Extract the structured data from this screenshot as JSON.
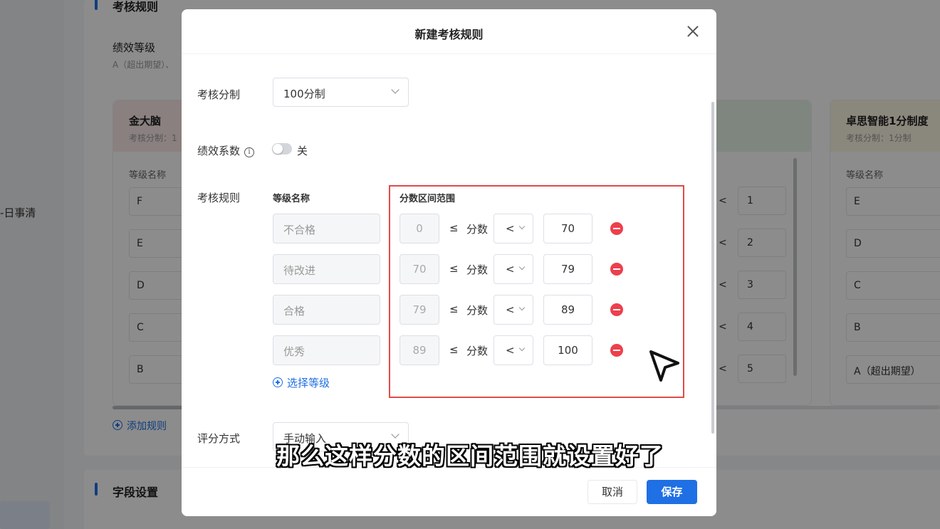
{
  "background": {
    "nav_item": "日事清",
    "section_title": "考核规则",
    "perf_level_title": "绩效等级",
    "perf_level_sub": "A（超出期望）、",
    "add_rule": "添加规则",
    "field_settings": "字段设置",
    "card_left": {
      "name": "金大脑",
      "sub": "考核分制：1",
      "grade_label": "等级名称",
      "grades": [
        "F",
        "E",
        "D",
        "C",
        "B"
      ]
    },
    "card_right": {
      "name": "卓思智能1分制度",
      "sub": "考核分制：1分制",
      "grade_label": "等级名称",
      "grades": [
        "E",
        "D",
        "C",
        "B",
        "A（超出期望）"
      ]
    },
    "right_values": [
      "1",
      "2",
      "3",
      "4",
      "5"
    ],
    "lt_symbol": "<"
  },
  "modal": {
    "title": "新建考核规则",
    "score_system_label": "考核分制",
    "score_system_value": "100分制",
    "coefficient_label": "绩效系数",
    "coefficient_toggle_text": "关",
    "rules_label": "考核规则",
    "col_grade_name": "等级名称",
    "col_score_range": "分数区间范围",
    "le_symbol": "≤",
    "score_word": "分数",
    "rows": [
      {
        "grade": "不合格",
        "min": "0",
        "op": "<",
        "max": "70"
      },
      {
        "grade": "待改进",
        "min": "70",
        "op": "<",
        "max": "79"
      },
      {
        "grade": "合格",
        "min": "79",
        "op": "<",
        "max": "89"
      },
      {
        "grade": "优秀",
        "min": "89",
        "op": "<",
        "max": "100"
      }
    ],
    "add_grade": "选择等级",
    "scoring_method_label": "评分方式",
    "scoring_method_value": "手动输入",
    "cancel": "取消",
    "save": "保存"
  },
  "caption": "那么这样分数的区间范围就设置好了",
  "colors": {
    "accent": "#1f6fe5",
    "danger": "#ee3f4c",
    "highlight": "#e24a4a"
  }
}
